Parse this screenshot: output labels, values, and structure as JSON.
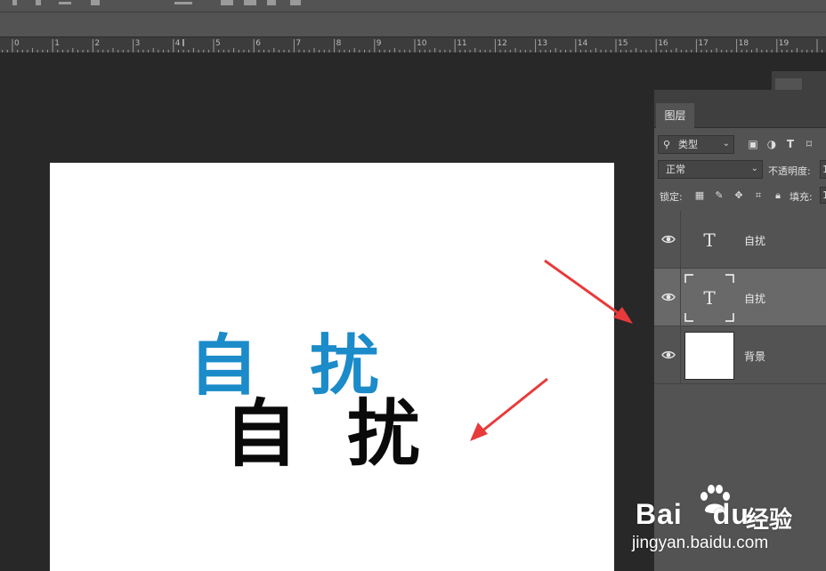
{
  "ruler": {
    "labels": [
      "1",
      "0",
      "1",
      "2",
      "3",
      "4",
      "5",
      "6",
      "7",
      "8",
      "9",
      "10",
      "11",
      "12",
      "13",
      "14",
      "15",
      "16",
      "17",
      "18",
      "19"
    ]
  },
  "canvas": {
    "word_blue": "自扰",
    "word_black": "自扰",
    "blue_color": "#1b8bc9",
    "arrow_color": "#e83a3a"
  },
  "layers_panel": {
    "tab_label": "图层",
    "filter": {
      "selected": "类型",
      "icons": [
        "image-filter-icon",
        "adjustment-filter-icon",
        "type-filter-icon",
        "shape-filter-icon"
      ]
    },
    "blend_mode": "正常",
    "opacity_label": "不透明度:",
    "opacity_value": "1",
    "lock_label": "锁定:",
    "lock_icons": [
      "lock-transparent-icon",
      "lock-paint-icon",
      "lock-move-icon",
      "lock-artboard-icon",
      "lock-all-icon"
    ],
    "fill_label": "填充:",
    "fill_value": "1",
    "layers": [
      {
        "name": "自扰",
        "type": "text",
        "thumb_glyph": "T",
        "selected": false
      },
      {
        "name": "自扰",
        "type": "text",
        "thumb_glyph": "T",
        "selected": true
      },
      {
        "name": "背景",
        "type": "background",
        "thumb_glyph": "",
        "selected": false
      }
    ]
  },
  "watermark": {
    "brand": "Bai",
    "brand_tail": "du",
    "cn": "经验",
    "url": "jingyan.baidu.com"
  }
}
